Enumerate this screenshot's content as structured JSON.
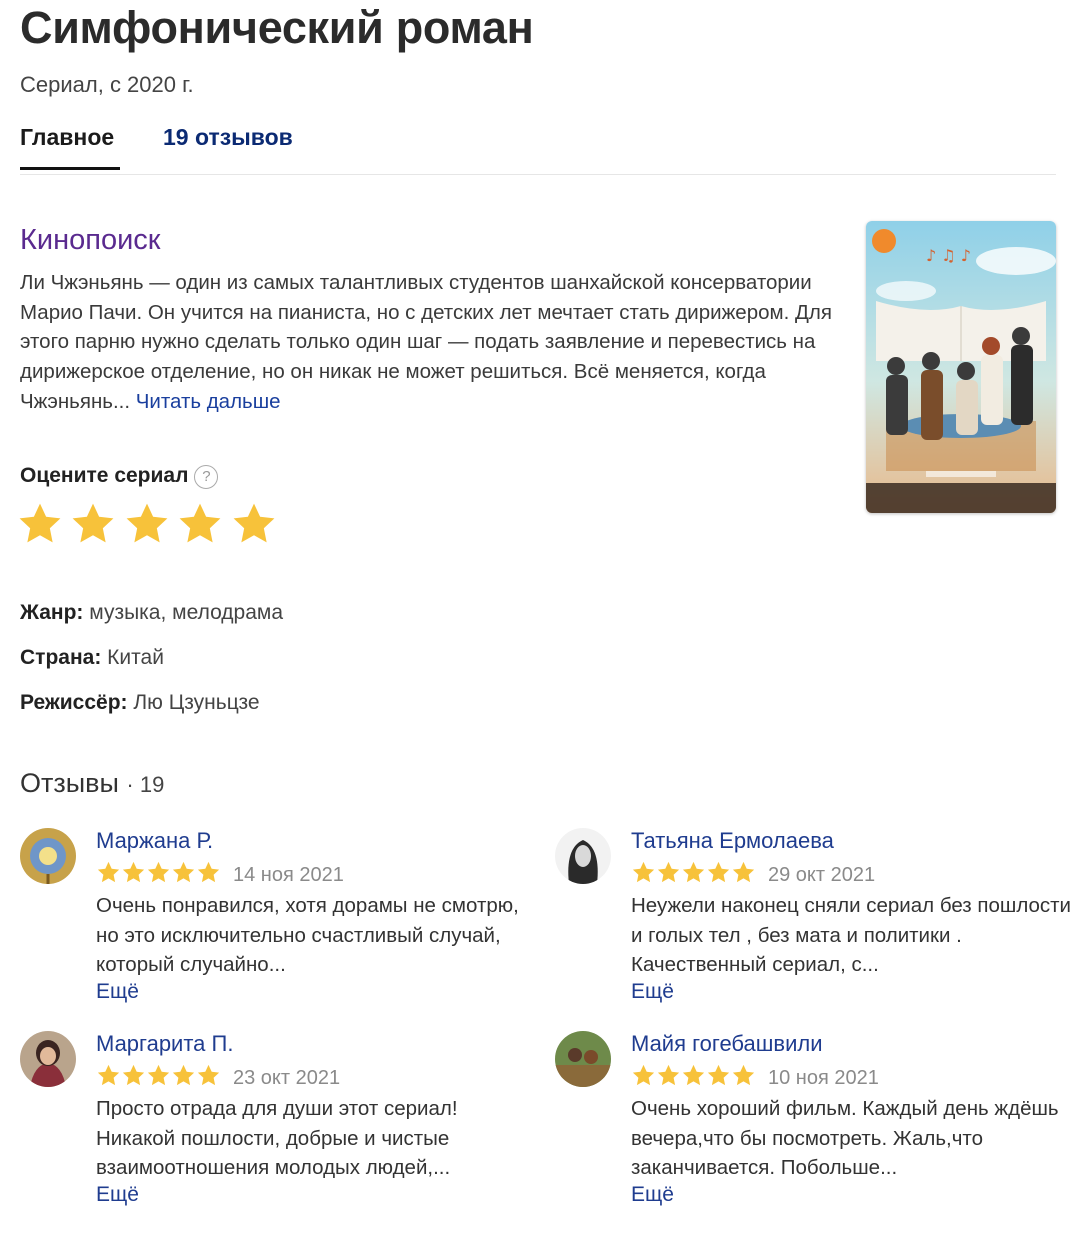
{
  "page": {
    "title": "Симфонический роман",
    "subtitle": "Сериал, с 2020 г."
  },
  "tabs": [
    {
      "label": "Главное"
    },
    {
      "label": "19 отзывов"
    }
  ],
  "summary": {
    "source": "Кинопоиск",
    "text": "Ли Чжэньянь — один из самых талантливых студентов шанхайской консерватории Марио Пачи. Он учится на пианиста, но с детских лет мечтает стать дирижером. Для этого парню нужно сделать только один шаг — подать заявление и перевестись на дирижерское отделение, но он никак не может решиться. Всё меняется, когда Чжэньянь...",
    "read_more": "Читать дальше"
  },
  "rating": {
    "label": "Оцените сериал",
    "help_icon": "question-circle-icon",
    "help_symbol": "?",
    "stars": 5,
    "star_color": "#f7c23a"
  },
  "info": {
    "genre_label": "Жанр:",
    "genre_value": "музыка, мелодрама",
    "country_label": "Страна:",
    "country_value": "Китай",
    "director_label": "Режиссёр:",
    "director_value": "Лю Цзуньцзе"
  },
  "reviews_section": {
    "title": "Отзывы",
    "count": "· 19",
    "more_label": "Ещё",
    "items": [
      {
        "author": "Маржана Р.",
        "date": "14 ноя 2021",
        "rating": 5,
        "text": "Очень понравился, хотя дорамы не смотрю, но это исключительно счастливый случай, который случайно..."
      },
      {
        "author": "Татьяна Ермолаева",
        "date": "29 окт 2021",
        "rating": 5,
        "text": "Неужели наконец сняли сериал без пошлости и голых тел , без мата и политики . Качественный сериал, с..."
      },
      {
        "author": "Маргарита П.",
        "date": "23 окт 2021",
        "rating": 5,
        "text": "Просто отрада для души этот сериал! Никакой пошлости, добрые и чистые взаимоотношения молодых людей,..."
      },
      {
        "author": "Майя гогебашвили",
        "date": "10 ноя 2021",
        "rating": 5,
        "text": "Очень хороший фильм. Каждый день ждёшь вечера,что бы посмотреть. Жаль,что заканчивается. Побольше..."
      }
    ]
  }
}
